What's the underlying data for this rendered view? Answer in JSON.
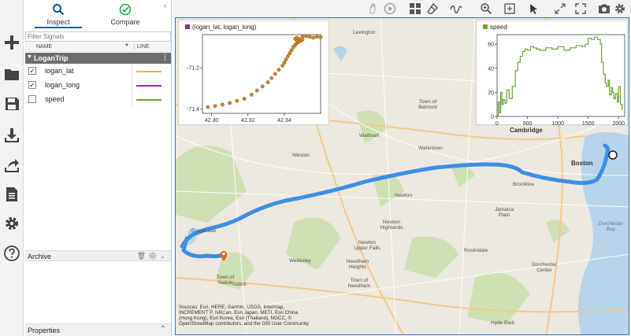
{
  "left_toolbar": {
    "items": [
      "new",
      "open",
      "save",
      "import",
      "export",
      "report",
      "settings",
      "help"
    ]
  },
  "panel": {
    "tabs": [
      {
        "label": "Inspect",
        "icon": "search-icon"
      },
      {
        "label": "Compare",
        "icon": "check-circle-icon"
      }
    ],
    "filter_placeholder": "Filter Signals",
    "columns": {
      "name": "NAME",
      "line": "LINE"
    },
    "group": "LoganTrip",
    "signals": [
      {
        "name": "logan_lat",
        "checked": true,
        "color": "#f4b12c"
      },
      {
        "name": "logan_long",
        "checked": true,
        "color": "#8b2f9c"
      },
      {
        "name": "speed",
        "checked": false,
        "color": "#6aa63a"
      }
    ],
    "archive_title": "Archive",
    "properties_title": "Properties"
  },
  "map": {
    "place_labels": [
      {
        "text": "Lexington"
      },
      {
        "text": "Town of Belmont"
      },
      {
        "text": "Cambridge"
      },
      {
        "text": "Boston"
      },
      {
        "text": "Waltham"
      },
      {
        "text": "Watertown"
      },
      {
        "text": "Weston"
      },
      {
        "text": "Newton"
      },
      {
        "text": "Newton Highlands"
      },
      {
        "text": "Newton Upper Falls"
      },
      {
        "text": "Cochituate"
      },
      {
        "text": "Wellesley"
      },
      {
        "text": "Needham Heights"
      },
      {
        "text": "Town of Needham"
      },
      {
        "text": "Town of Natick"
      },
      {
        "text": "Natick"
      },
      {
        "text": "Jamaica Plain"
      },
      {
        "text": "Roslindale"
      },
      {
        "text": "Dorchester Center"
      },
      {
        "text": "Dorchester Bay"
      },
      {
        "text": "Hyde Park"
      },
      {
        "text": "Brookline"
      }
    ],
    "credits": "Sources: Esri, HERE, Garmin, USGS, Intermap, INCREMENT P, NRCan, Esri Japan, METI, Esri China (Hong Kong), Esri Korea, Esri (Thailand), NGCC, © OpenStreetMap contributors, and the GIS User Community",
    "route_color": "#3d8ee6"
  },
  "chart_data": [
    {
      "type": "scatter",
      "title": "(logan_lat, logan_long)",
      "legend_color": "#8b2f9c",
      "marker_color": "#c9862a",
      "xlim": [
        42.295,
        42.36
      ],
      "ylim": [
        -71.42,
        -71.04
      ],
      "xticks": [
        "42.30",
        "42.32",
        "42.34"
      ],
      "yticks": [
        "-71.2",
        "-71.4"
      ],
      "x": [
        42.298,
        42.302,
        42.306,
        42.31,
        42.314,
        42.318,
        42.322,
        42.325,
        42.328,
        42.331,
        42.333,
        42.335,
        42.337,
        42.339,
        42.34,
        42.341,
        42.342,
        42.343,
        42.344,
        42.345,
        42.346,
        42.347,
        42.348,
        42.349,
        42.35,
        42.348,
        42.347,
        42.346,
        42.347,
        42.35,
        42.352,
        42.354,
        42.356,
        42.358,
        42.36
      ],
      "y": [
        -71.39,
        -71.385,
        -71.378,
        -71.37,
        -71.36,
        -71.35,
        -71.33,
        -71.31,
        -71.29,
        -71.27,
        -71.25,
        -71.23,
        -71.21,
        -71.19,
        -71.175,
        -71.16,
        -71.145,
        -71.13,
        -71.115,
        -71.1,
        -71.09,
        -71.08,
        -71.075,
        -71.07,
        -71.065,
        -71.06,
        -71.07,
        -71.06,
        -71.055,
        -71.05,
        -71.048,
        -71.05,
        -71.055,
        -71.05,
        -71.052
      ]
    },
    {
      "type": "line",
      "title": "speed",
      "color": "#6aa63a",
      "xlim": [
        0,
        2100
      ],
      "ylim": [
        0,
        68
      ],
      "xticks": [
        "0",
        "500",
        "1000",
        "1500",
        "2000"
      ],
      "yticks": [
        "0",
        "20",
        "40",
        "60"
      ],
      "x": [
        0,
        20,
        40,
        60,
        80,
        100,
        130,
        160,
        200,
        250,
        300,
        340,
        380,
        420,
        460,
        500,
        550,
        600,
        650,
        700,
        800,
        900,
        1000,
        1100,
        1200,
        1300,
        1400,
        1450,
        1500,
        1550,
        1600,
        1650,
        1700,
        1720,
        1750,
        1780,
        1800,
        1830,
        1850,
        1880,
        1900,
        1920,
        1950,
        1980,
        2000,
        2030,
        2060
      ],
      "y": [
        0,
        12,
        3,
        20,
        10,
        14,
        11,
        22,
        15,
        25,
        38,
        45,
        50,
        54,
        56,
        55,
        58,
        57,
        56,
        55,
        57,
        56,
        58,
        55,
        57,
        59,
        58,
        60,
        65,
        64,
        66,
        64,
        60,
        45,
        35,
        28,
        25,
        30,
        18,
        24,
        20,
        15,
        19,
        12,
        25,
        10,
        5
      ]
    }
  ]
}
